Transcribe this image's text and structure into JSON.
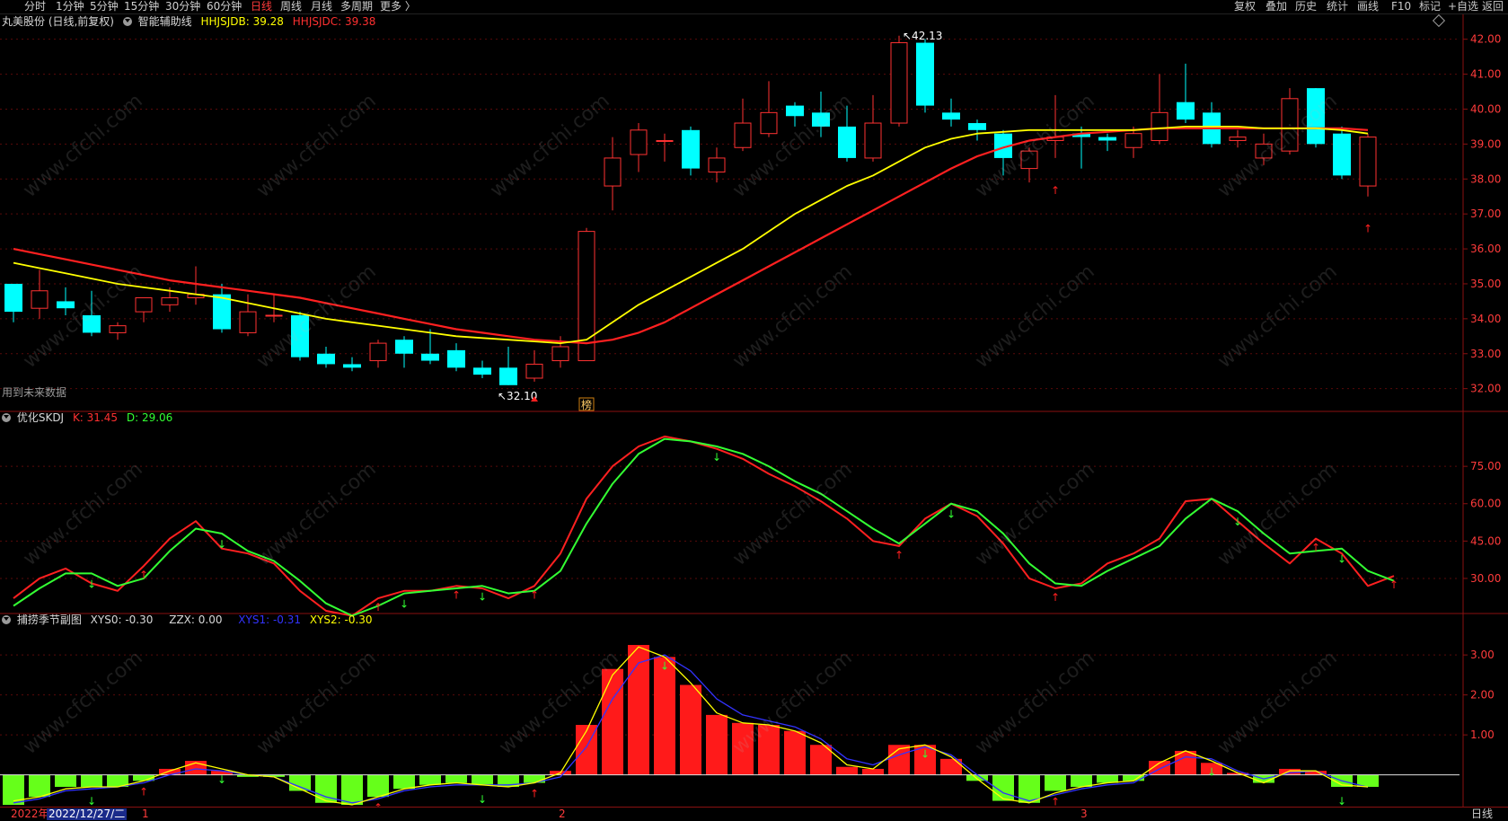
{
  "toolbar": {
    "left": [
      "分时",
      "1分钟",
      "5分钟",
      "15分钟",
      "30分钟",
      "60分钟",
      "日线",
      "周线",
      "月线",
      "多周期",
      "更多 〉"
    ],
    "active": "日线",
    "right": [
      "复权",
      "叠加",
      "历史",
      "统计",
      "画线",
      "F10",
      "标记",
      "+自选",
      "返回"
    ]
  },
  "main_panel": {
    "title": "丸美股份 (日线,前复权)",
    "indicator_name": "智能辅助线",
    "ma1_label": "HHJSJDB: 39.28",
    "ma2_label": "HHJSJDC: 39.38",
    "note": "用到未来数据",
    "high_annotation": "42.13",
    "low_annotation": "32.10",
    "badge": "榜"
  },
  "kdj_panel": {
    "title": "优化SKDJ",
    "k_label": "K: 31.45",
    "d_label": "D: 29.06"
  },
  "season_panel": {
    "title": "捕捞季节副图",
    "xys0_label": "XYS0: -0.30",
    "zzx_label": "ZZX: 0.00",
    "xys1_label": "XYS1: -0.31",
    "xys2_label": "XYS2: -0.30"
  },
  "bottom_axis": {
    "first_label": "2022年",
    "cursor_date": "2022/12/27/二",
    "month_labels": [
      "1",
      "2",
      "3"
    ],
    "period_label": "日线"
  },
  "watermark": "www.cfchi.com",
  "colors": {
    "up": "#ff3232",
    "down": "#00ffff",
    "ma1": "#ffff00",
    "ma2": "#ff2020",
    "k_line": "#ff2020",
    "d_line": "#33ff33",
    "bar_pos": "#ff1a1a",
    "bar_neg": "#66ff1a",
    "xys1": "#3333ff",
    "xys2": "#ffff00",
    "grid": "#5a0a0a",
    "axis_text": "#ff3b3b"
  },
  "chart_data": [
    {
      "type": "candlestick",
      "title": "丸美股份 (日线,前复权)",
      "ylim": [
        31.4,
        42.3
      ],
      "yticks": [
        32.0,
        33.0,
        34.0,
        35.0,
        36.0,
        37.0,
        38.0,
        39.0,
        40.0,
        41.0,
        42.0
      ],
      "candles": [
        [
          35.0,
          34.2,
          35.0,
          33.9
        ],
        [
          34.3,
          34.8,
          35.4,
          34.0
        ],
        [
          34.5,
          34.3,
          34.9,
          34.1
        ],
        [
          34.1,
          33.6,
          34.8,
          33.5
        ],
        [
          33.6,
          33.8,
          33.9,
          33.4
        ],
        [
          34.2,
          34.6,
          34.6,
          33.9
        ],
        [
          34.4,
          34.6,
          34.9,
          34.2
        ],
        [
          34.6,
          34.7,
          35.5,
          34.4
        ],
        [
          34.7,
          33.7,
          35.0,
          33.6
        ],
        [
          33.6,
          34.2,
          34.7,
          33.5
        ],
        [
          34.1,
          34.1,
          34.7,
          33.9
        ],
        [
          34.1,
          32.9,
          34.2,
          32.8
        ],
        [
          33.0,
          32.7,
          33.2,
          32.6
        ],
        [
          32.7,
          32.6,
          32.9,
          32.5
        ],
        [
          32.8,
          33.3,
          33.4,
          32.6
        ],
        [
          33.4,
          33.0,
          33.5,
          32.6
        ],
        [
          33.0,
          32.8,
          33.7,
          32.7
        ],
        [
          33.1,
          32.6,
          33.3,
          32.5
        ],
        [
          32.6,
          32.4,
          32.8,
          32.3
        ],
        [
          32.6,
          32.1,
          33.2,
          32.1
        ],
        [
          32.3,
          32.7,
          33.1,
          32.2
        ],
        [
          32.8,
          33.2,
          33.5,
          32.6
        ],
        [
          32.8,
          36.5,
          36.6,
          32.8
        ],
        [
          37.8,
          38.6,
          39.2,
          37.1
        ],
        [
          38.7,
          39.4,
          39.6,
          38.2
        ],
        [
          39.1,
          39.1,
          39.3,
          38.5
        ],
        [
          39.4,
          38.3,
          39.5,
          38.1
        ],
        [
          38.2,
          38.6,
          38.9,
          37.9
        ],
        [
          38.9,
          39.6,
          40.3,
          38.8
        ],
        [
          39.3,
          39.9,
          40.8,
          39.2
        ],
        [
          40.1,
          39.8,
          40.2,
          39.5
        ],
        [
          39.9,
          39.5,
          40.5,
          39.2
        ],
        [
          39.5,
          38.6,
          40.1,
          38.5
        ],
        [
          38.6,
          39.6,
          40.4,
          38.5
        ],
        [
          39.6,
          41.9,
          42.1,
          39.5
        ],
        [
          41.9,
          40.1,
          42.0,
          39.9
        ],
        [
          39.9,
          39.7,
          40.3,
          39.5
        ],
        [
          39.6,
          39.4,
          39.7,
          39.1
        ],
        [
          39.3,
          38.6,
          39.4,
          38.1
        ],
        [
          38.3,
          38.8,
          38.9,
          37.9
        ],
        [
          39.1,
          39.2,
          40.4,
          38.6
        ],
        [
          39.3,
          39.2,
          39.5,
          38.3
        ],
        [
          39.2,
          39.1,
          39.3,
          38.8
        ],
        [
          38.9,
          39.3,
          39.5,
          38.6
        ],
        [
          39.1,
          39.9,
          41.0,
          39.0
        ],
        [
          40.2,
          39.7,
          41.3,
          39.6
        ],
        [
          39.9,
          39.0,
          40.2,
          38.9
        ],
        [
          39.1,
          39.2,
          39.4,
          38.9
        ],
        [
          38.6,
          39.0,
          39.3,
          38.4
        ],
        [
          38.8,
          40.3,
          40.6,
          38.7
        ],
        [
          40.6,
          39.0,
          40.6,
          38.9
        ],
        [
          39.3,
          38.1,
          39.5,
          38.0
        ],
        [
          37.8,
          39.2,
          39.3,
          37.5
        ]
      ],
      "ma1": [
        35.6,
        35.45,
        35.3,
        35.15,
        35.0,
        34.9,
        34.8,
        34.7,
        34.6,
        34.45,
        34.3,
        34.15,
        34.0,
        33.9,
        33.8,
        33.7,
        33.6,
        33.5,
        33.45,
        33.4,
        33.35,
        33.3,
        33.4,
        33.9,
        34.4,
        34.8,
        35.2,
        35.6,
        36.0,
        36.5,
        37.0,
        37.4,
        37.8,
        38.1,
        38.5,
        38.9,
        39.15,
        39.3,
        39.35,
        39.4,
        39.4,
        39.4,
        39.4,
        39.4,
        39.45,
        39.5,
        39.5,
        39.5,
        39.45,
        39.45,
        39.45,
        39.4,
        39.3
      ],
      "ma2": [
        36.0,
        35.85,
        35.7,
        35.55,
        35.4,
        35.25,
        35.1,
        35.0,
        34.9,
        34.8,
        34.7,
        34.6,
        34.45,
        34.3,
        34.15,
        34.0,
        33.85,
        33.7,
        33.6,
        33.5,
        33.4,
        33.35,
        33.3,
        33.4,
        33.6,
        33.9,
        34.3,
        34.7,
        35.1,
        35.5,
        35.9,
        36.3,
        36.7,
        37.1,
        37.5,
        37.9,
        38.3,
        38.65,
        38.9,
        39.1,
        39.2,
        39.3,
        39.35,
        39.4,
        39.45,
        39.45,
        39.45,
        39.45,
        39.45,
        39.45,
        39.45,
        39.45,
        39.4
      ],
      "up_arrows": [
        40,
        52
      ],
      "triangle_at": 20
    },
    {
      "type": "line",
      "title": "优化SKDJ",
      "ylim": [
        17,
        92
      ],
      "yticks": [
        30.0,
        45.0,
        60.0,
        75.0
      ],
      "series": [
        {
          "name": "K",
          "values": [
            22,
            30,
            34,
            28,
            25,
            35,
            46,
            53,
            42,
            40,
            36,
            25,
            17,
            15,
            22,
            25,
            25,
            27,
            26,
            22,
            27,
            40,
            62,
            75,
            83,
            87,
            85,
            82,
            78,
            72,
            67,
            61,
            54,
            45,
            43,
            54,
            60,
            55,
            44,
            30,
            26,
            28,
            36,
            40,
            46,
            61,
            62,
            53,
            44,
            36,
            46,
            40,
            27,
            31
          ]
        },
        {
          "name": "D",
          "values": [
            19,
            26,
            32,
            32,
            27,
            30,
            41,
            50,
            48,
            41,
            37,
            29,
            20,
            15,
            19,
            24,
            25,
            26,
            27,
            24,
            25,
            33,
            52,
            68,
            80,
            86,
            85,
            83,
            80,
            75,
            69,
            64,
            57,
            50,
            44,
            52,
            60,
            57,
            48,
            36,
            28,
            27,
            33,
            38,
            43,
            54,
            62,
            57,
            48,
            40,
            41,
            42,
            33,
            29
          ]
        }
      ],
      "down_arrows": [
        3,
        8,
        15,
        18,
        27,
        36,
        47,
        51
      ],
      "up_arrows": [
        5,
        14,
        17,
        20,
        34,
        40,
        50,
        53
      ]
    },
    {
      "type": "bar",
      "title": "捕捞季节副图",
      "ylim": [
        -0.75,
        3.7
      ],
      "yticks": [
        1.0,
        2.0,
        3.0
      ],
      "values": [
        -0.75,
        -0.55,
        -0.3,
        -0.3,
        -0.3,
        -0.15,
        0.15,
        0.35,
        0.1,
        -0.05,
        -0.05,
        -0.4,
        -0.7,
        -0.75,
        -0.55,
        -0.35,
        -0.25,
        -0.2,
        -0.25,
        -0.3,
        -0.2,
        0.1,
        1.25,
        2.65,
        3.25,
        2.95,
        2.25,
        1.5,
        1.3,
        1.25,
        1.1,
        0.75,
        0.2,
        0.15,
        0.75,
        0.75,
        0.4,
        -0.15,
        -0.65,
        -0.7,
        -0.4,
        -0.3,
        -0.2,
        -0.15,
        0.35,
        0.6,
        0.3,
        0.05,
        -0.2,
        0.15,
        0.1,
        -0.3,
        -0.3
      ],
      "series": [
        {
          "name": "XYS1",
          "values": [
            -0.7,
            -0.6,
            -0.4,
            -0.35,
            -0.3,
            -0.2,
            0.0,
            0.15,
            0.1,
            0.0,
            -0.05,
            -0.3,
            -0.55,
            -0.7,
            -0.6,
            -0.4,
            -0.3,
            -0.25,
            -0.25,
            -0.25,
            -0.2,
            -0.05,
            0.7,
            1.9,
            2.8,
            3.0,
            2.6,
            1.9,
            1.5,
            1.35,
            1.2,
            0.9,
            0.4,
            0.25,
            0.5,
            0.7,
            0.5,
            0.0,
            -0.45,
            -0.65,
            -0.5,
            -0.35,
            -0.25,
            -0.2,
            0.15,
            0.45,
            0.4,
            0.1,
            -0.1,
            0.05,
            0.1,
            -0.15,
            -0.31
          ]
        },
        {
          "name": "XYS2",
          "values": [
            -0.65,
            -0.55,
            -0.35,
            -0.3,
            -0.3,
            -0.15,
            0.1,
            0.3,
            0.15,
            0.0,
            -0.05,
            -0.35,
            -0.65,
            -0.75,
            -0.55,
            -0.35,
            -0.25,
            -0.2,
            -0.25,
            -0.3,
            -0.2,
            0.05,
            1.1,
            2.5,
            3.2,
            2.95,
            2.3,
            1.55,
            1.3,
            1.25,
            1.1,
            0.8,
            0.25,
            0.15,
            0.65,
            0.75,
            0.45,
            -0.1,
            -0.6,
            -0.7,
            -0.45,
            -0.3,
            -0.2,
            -0.15,
            0.3,
            0.6,
            0.35,
            0.05,
            -0.2,
            0.1,
            0.1,
            -0.25,
            -0.3
          ]
        }
      ],
      "down_arrows": [
        3,
        8,
        18,
        25,
        35,
        46,
        51
      ],
      "up_arrows": [
        5,
        14,
        20,
        40,
        53
      ]
    }
  ]
}
